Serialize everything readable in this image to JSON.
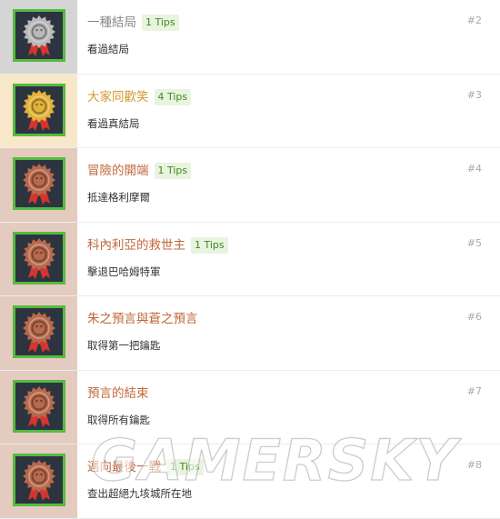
{
  "achievements": [
    {
      "tier": "silver",
      "title": "一種結局",
      "tips": "1 Tips",
      "desc": "看過結局",
      "num": "#2"
    },
    {
      "tier": "gold",
      "title": "大家同歡笑",
      "tips": "4 Tips",
      "desc": "看過真結局",
      "num": "#3"
    },
    {
      "tier": "bronze",
      "title": "冒險的開端",
      "tips": "1 Tips",
      "desc": "抵達格利摩爾",
      "num": "#4"
    },
    {
      "tier": "bronze",
      "title": "科內利亞的救世主",
      "tips": "1 Tips",
      "desc": "擊退巴哈姆特軍",
      "num": "#5"
    },
    {
      "tier": "bronze",
      "title": "朱之預言與蒼之預言",
      "tips": "",
      "desc": "取得第一把鑰匙",
      "num": "#6"
    },
    {
      "tier": "bronze",
      "title": "預言的結束",
      "tips": "",
      "desc": "取得所有鑰匙",
      "num": "#7"
    },
    {
      "tier": "bronze",
      "title": "邁向最後一戰",
      "tips": "1 Tips",
      "desc": "查出超絕九垓城所在地",
      "num": "#8"
    }
  ],
  "colors": {
    "silver": "#b9b9b9",
    "gold": "#e2b33a",
    "bronze": "#b86a4c",
    "ribbon": "#d6342f",
    "frame": "#57b941"
  },
  "icons": {
    "badge": "medal-icon"
  },
  "watermark": "GAMERSKY"
}
